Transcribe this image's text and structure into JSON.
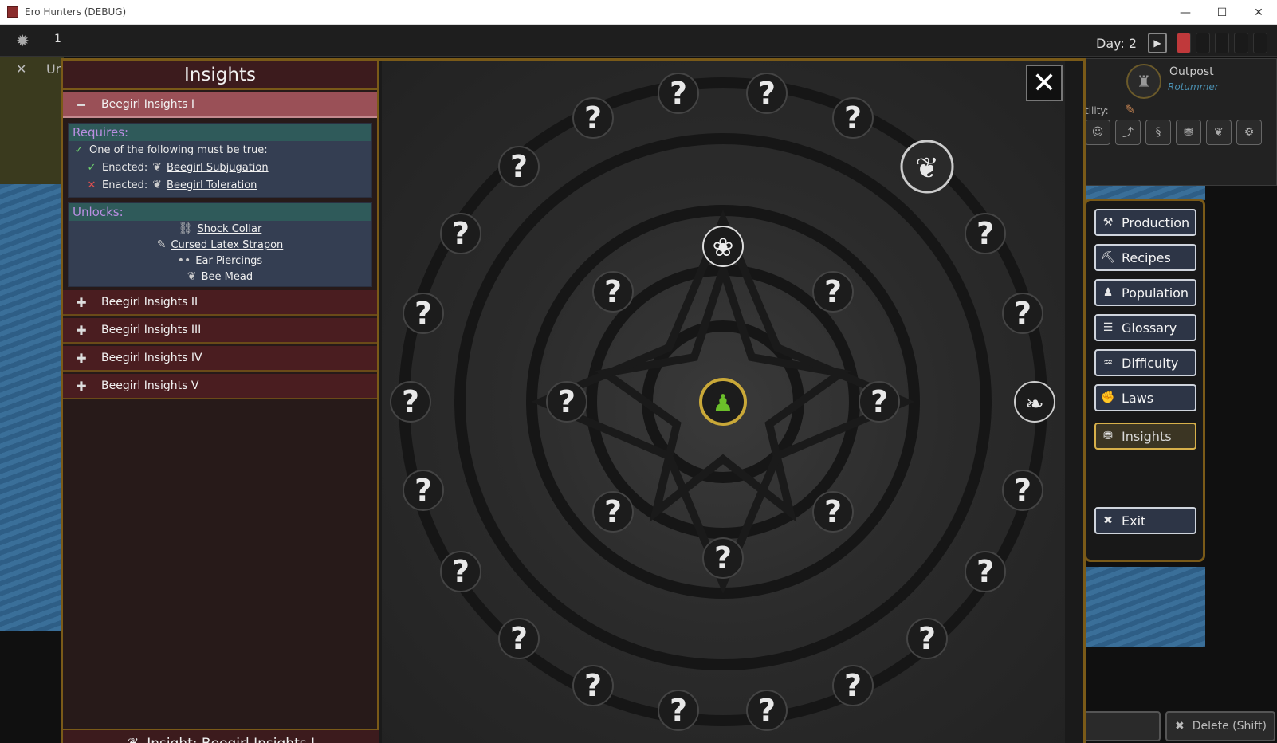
{
  "window": {
    "title": "Ero Hunters (DEBUG)",
    "minimize": "—",
    "maximize": "☐",
    "close": "✕"
  },
  "hud": {
    "gear": "✹",
    "resource_count": "1",
    "close_x": "✕",
    "un_label": "Ur",
    "day_label": "Day: 2",
    "play": "▶",
    "outpost_name": "Outpost",
    "outpost_sub": "Rotummer",
    "utility_label": "tility:"
  },
  "menu": {
    "items": [
      {
        "label": "Production",
        "icon": "hammer-icon",
        "glyph": "⚒"
      },
      {
        "label": "Recipes",
        "icon": "pickaxe-icon",
        "glyph": "⛏"
      },
      {
        "label": "Population",
        "icon": "person-icon",
        "glyph": "♟"
      },
      {
        "label": "Glossary",
        "icon": "list-icon",
        "glyph": "☰"
      },
      {
        "label": "Difficulty",
        "icon": "mask-icon",
        "glyph": "♒"
      },
      {
        "label": "Laws",
        "icon": "fist-icon",
        "glyph": "✊"
      },
      {
        "label": "Insights",
        "icon": "basket-icon",
        "glyph": "⛃"
      }
    ],
    "exit_label": "Exit",
    "exit_glyph": "✖"
  },
  "bottom": {
    "left_label": ")",
    "delete_label": "Delete (Shift)",
    "delete_glyph": "✖"
  },
  "insights": {
    "title": "Insights",
    "selected": {
      "label": "Beegirl Insights I",
      "glyph": "━"
    },
    "requires_header": "Requires:",
    "condition": "One of the following must be true:",
    "enacted_label": "Enacted:",
    "req_items": [
      {
        "name": "Beegirl Subjugation",
        "met": true
      },
      {
        "name": "Beegirl Toleration",
        "met": false
      }
    ],
    "unlocks_header": "Unlocks:",
    "unlocks": [
      {
        "name": "Shock Collar",
        "glyph": "⛓"
      },
      {
        "name": "Cursed Latex Strapon",
        "glyph": "✎"
      },
      {
        "name": "Ear Piercings",
        "glyph": "••"
      },
      {
        "name": "Bee Mead",
        "glyph": "❦"
      }
    ],
    "others": [
      {
        "label": "Beegirl Insights II",
        "glyph": "✚"
      },
      {
        "label": "Beegirl Insights III",
        "glyph": "✚"
      },
      {
        "label": "Beegirl Insights IV",
        "glyph": "✚"
      },
      {
        "label": "Beegirl Insights V",
        "glyph": "✚"
      }
    ],
    "footer": "Insight: Beegirl Insights I",
    "footer_glyph": "❦"
  },
  "tree": {
    "unknown_glyph": "?",
    "close": "✕",
    "center_node": "character-icon",
    "unlocked_nodes": [
      "flower-icon",
      "bee-fairy-icon",
      "leaf-icon"
    ],
    "colors": {
      "center_ring": "#c9a838",
      "center_fill": "#6bbf2a"
    }
  }
}
